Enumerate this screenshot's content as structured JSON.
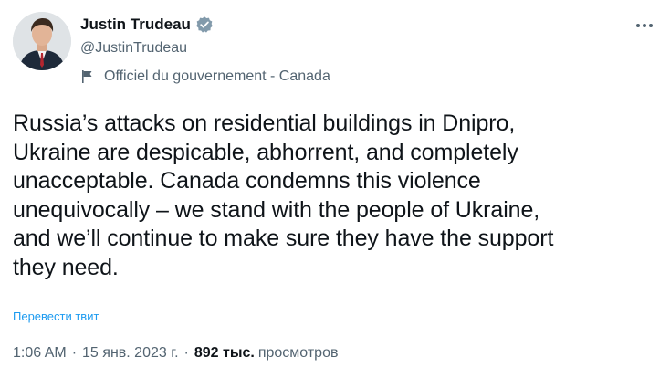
{
  "author": {
    "display_name": "Justin Trudeau",
    "handle": "@JustinTrudeau",
    "verified_icon": "verified-badge-icon",
    "gov_label": "Officiel du gouvernement - Canada",
    "gov_icon": "flag-icon"
  },
  "tweet": {
    "text": "Russia’s attacks on residential buildings in Dnipro,\nUkraine are despicable, abhorrent, and completely\nunacceptable. Canada condemns this violence\nunequivocally – we stand with the people of Ukraine,\nand we’ll continue to make sure they have the support\nthey need.",
    "translate_label": "Перевести твит"
  },
  "meta": {
    "time": "1:06 AM",
    "separator": "·",
    "date": "15 янв. 2023 г.",
    "views_count": "892 тыс.",
    "views_label": "просмотров"
  },
  "colors": {
    "accent": "#1d9bf0",
    "secondary_text": "#536471",
    "primary_text": "#0f1419"
  },
  "icons": {
    "more": "more-horizontal-icon"
  }
}
